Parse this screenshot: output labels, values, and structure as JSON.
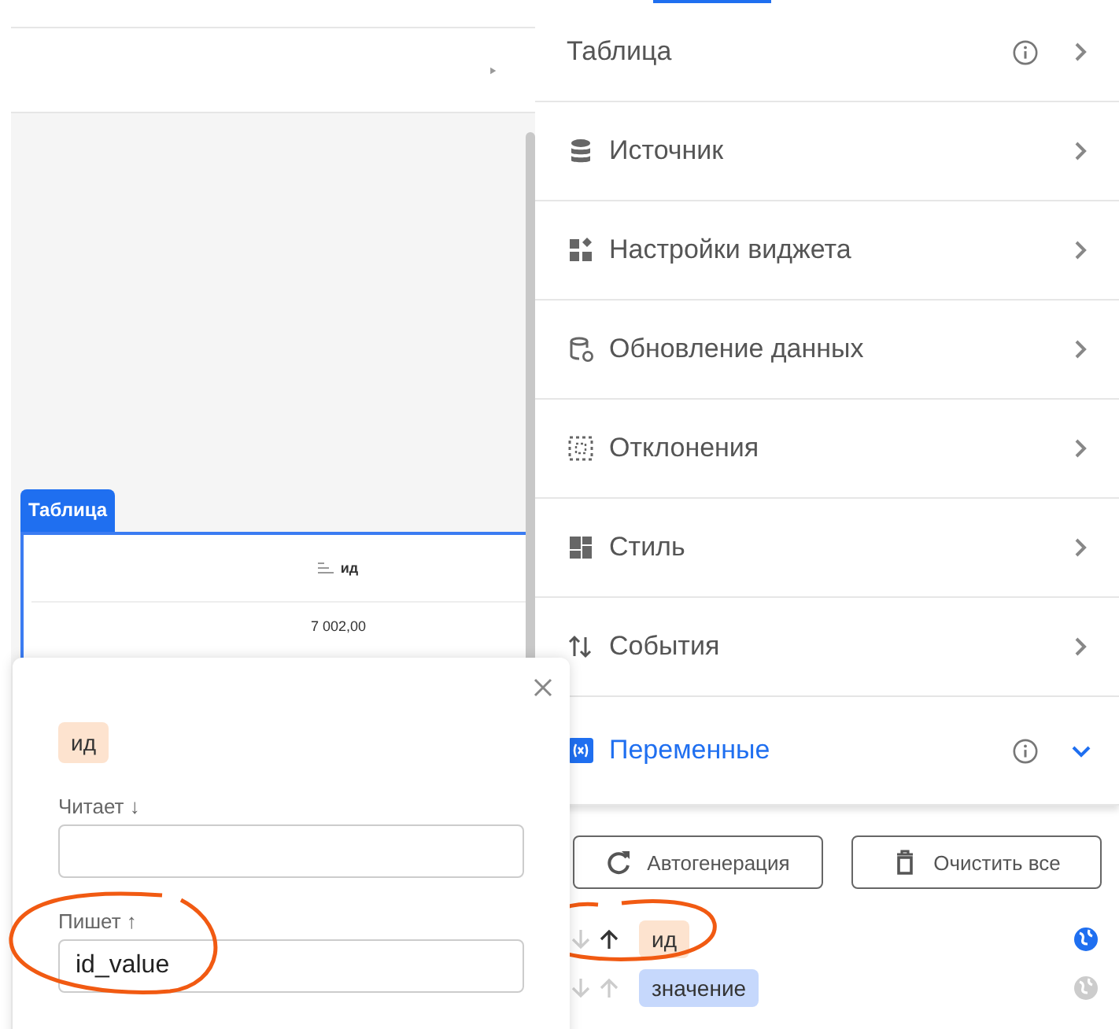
{
  "canvas": {
    "widget_tag": "Таблица",
    "table": {
      "columns": [
        {
          "label": "ид",
          "sortable": true
        }
      ],
      "rows": [
        [
          "7 002,00"
        ]
      ]
    }
  },
  "panel": {
    "items": [
      {
        "label": "Таблица",
        "info": true,
        "expanded": false
      },
      {
        "label": "Источник",
        "info": false,
        "expanded": false
      },
      {
        "label": "Настройки виджета",
        "info": false,
        "expanded": false
      },
      {
        "label": "Обновление данных",
        "info": false,
        "expanded": false
      },
      {
        "label": "Отклонения",
        "info": false,
        "expanded": false
      },
      {
        "label": "Стиль",
        "info": false,
        "expanded": false
      },
      {
        "label": "События",
        "info": false,
        "expanded": false
      },
      {
        "label": "Переменные",
        "info": true,
        "expanded": true
      }
    ],
    "buttons": [
      {
        "label": "Автогенерация"
      },
      {
        "label": "Очистить все"
      }
    ],
    "variables": [
      {
        "name": "ид",
        "color": "#fde3cf",
        "reads": false,
        "writes": true,
        "global": true,
        "circled": true
      },
      {
        "name": "значение",
        "color": "#c6d8fc",
        "reads": false,
        "writes": false,
        "global": false,
        "circled": false
      }
    ]
  },
  "popup": {
    "chip": {
      "name": "ид",
      "color": "#fde3cf"
    },
    "fields": [
      {
        "label": "Читает ↓",
        "circled": false
      },
      {
        "label": "Пишет ↑",
        "value": "id_value",
        "circled": true
      }
    ]
  }
}
